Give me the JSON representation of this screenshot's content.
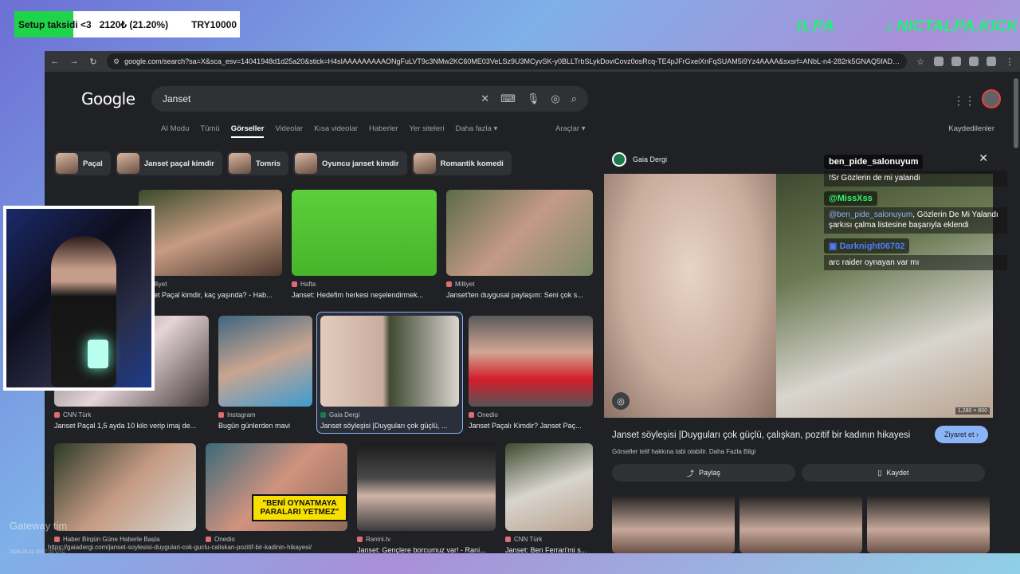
{
  "overlay": {
    "goal_label": "Setup taksidi <3",
    "goal_amount": "2120₺ (21.20%)",
    "goal_target": "TRY10000",
    "goal_progress": 0.212,
    "brand_left": "ILPA",
    "brand_right": "NICTALPA.KICK",
    "gateway": "Gateway tim",
    "gateway_sub": "2026-03-22 18:07:33 UTC"
  },
  "browser": {
    "url": "google.com/search?sa=X&sca_esv=14041948d1d25a20&stick=H4sIAAAAAAAAAONgFuLVT9c3NMw2KC60ME03VeLSz9U3MCyvSK-y0BLLTrbSLykDoviCovz0osRcq-TE4pJFrGxeiXnFqSUAM5i9Yz4AAAA&sxsrf=ANbL-n4-282rk5GNAQ5fADeR...",
    "status_url": "https://gaiadergi.com/janset-soylesisi-duygulari-cok-guclu-caliskan-pozitif-bir-kadinin-hikayesi/"
  },
  "search": {
    "logo": "Google",
    "query": "Janset",
    "tabs": [
      "AI Modu",
      "Tümü",
      "Görseller",
      "Videolar",
      "Kısa videolar",
      "Haberler",
      "Yer siteleri",
      "Daha fazla ▾"
    ],
    "tools": "Araçlar ▾",
    "saved": "Kaydedilenler",
    "chips": [
      "Paçal",
      "Janset paçal kimdir",
      "Tomris",
      "Oyuncu janset kimdir",
      "Romantik komedi"
    ]
  },
  "results": [
    {
      "source": "Milliyet",
      "title": "Janset Paçal kimdir, kaç yaşında? - Hab..."
    },
    {
      "source": "Hafta",
      "title": "Janset: Hedefim herkesi neşelendirmek..."
    },
    {
      "source": "Milliyet",
      "title": "Janset'ten duygusal paylaşım: Seni çok s..."
    },
    {
      "source": "CNN Türk",
      "title": "Janset Paçal 1,5 ayda 10 kilo verip imaj de..."
    },
    {
      "source": "Instagram",
      "title": "Bugün günlerden mavi"
    },
    {
      "source": "Gaia Dergi",
      "title": "Janset söyleşisi |Duyguları çok güçlü, ..."
    },
    {
      "source": "Onedio",
      "title": "Janset Paçalı Kimdir? Janset Paç..."
    },
    {
      "source": "Haber Birgün Güne Haberle Başla",
      "title": ""
    },
    {
      "source": "Onedio",
      "title": ""
    },
    {
      "source": "Ranini.tv",
      "title": "Janset: Gençlere borcumuz var! - Rani..."
    },
    {
      "source": "CNN Türk",
      "title": "Janset: Ben Ferrari'mi s..."
    }
  ],
  "quote_text": "\"BENİ OYNATMAYA PARALARI YETMEZ\"",
  "panel": {
    "source": "Gaia Dergi",
    "dims": "1,280 × 800",
    "title": "Janset söyleşisi |Duyguları çok güçlü, çalışkan, pozitif bir kadının hikayesi",
    "visit": "Ziyaret et",
    "note": "Görseller telif hakkına tabi olabilir.",
    "note_link": "Daha Fazla Bilgi",
    "share": "Paylaş",
    "save": "Kaydet"
  },
  "chat": [
    {
      "user": "ben_pide_salonuyum",
      "message": "!Sr Gözlerin de mi yalandi"
    },
    {
      "user": "@MissXss",
      "mention": "@ben_pide_salonuyum",
      "message": ", Gözlerin De Mi Yalandı şarkısı çalma listesine başarıyla eklendi"
    },
    {
      "user": "Darknight06702",
      "message": "arc raider oynayan var mı"
    }
  ]
}
